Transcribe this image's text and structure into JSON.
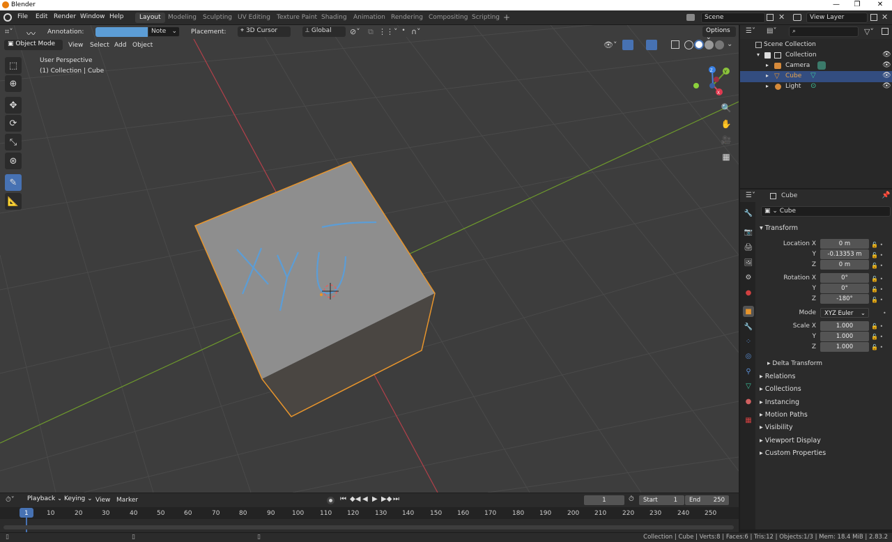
{
  "titlebar": {
    "title": "Blender",
    "min": "—",
    "max": "❐",
    "close": "✕"
  },
  "menu": [
    "File",
    "Edit",
    "Render",
    "Window",
    "Help"
  ],
  "workspaces": [
    "Layout",
    "Modeling",
    "Sculpting",
    "UV Editing",
    "Texture Paint",
    "Shading",
    "Animation",
    "Rendering",
    "Compositing",
    "Scripting"
  ],
  "scene": {
    "name": "Scene",
    "view_layer": "View Layer"
  },
  "tool_header": {
    "annotation_label": "Annotation:",
    "annotation_color": "#5c9dd6",
    "note": "Note",
    "placement_label": "Placement:",
    "placement_value": "3D Cursor",
    "orientation": "Global",
    "options": "Options"
  },
  "viewport_header": {
    "mode": "Object Mode",
    "view": "View",
    "select": "Select",
    "add": "Add",
    "object": "Object"
  },
  "viewport": {
    "perspective": "User Perspective",
    "collection": "(1) Collection | Cube",
    "annotation_text": "XYU"
  },
  "gizmo": {
    "x": "X",
    "y": "Y",
    "z": "Z"
  },
  "outliner": {
    "search_placeholder": "",
    "rows": [
      {
        "label": "Scene Collection"
      },
      {
        "label": "Collection"
      },
      {
        "label": "Camera"
      },
      {
        "label": "Cube"
      },
      {
        "label": "Light"
      }
    ]
  },
  "properties": {
    "object_name": "Cube",
    "data_name": "Cube",
    "transform_label": "Transform",
    "location_x_label": "Location X",
    "location_x": "0 m",
    "location_y_label": "Y",
    "location_y": "-0.13353 m",
    "location_z_label": "Z",
    "location_z": "0 m",
    "rotation_x_label": "Rotation X",
    "rotation_x": "0°",
    "rotation_y_label": "Y",
    "rotation_y": "0°",
    "rotation_z_label": "Z",
    "rotation_z": "-180°",
    "mode_label": "Mode",
    "mode": "XYZ Euler",
    "scale_x_label": "Scale X",
    "scale_x": "1.000",
    "scale_y_label": "Y",
    "scale_y": "1.000",
    "scale_z_label": "Z",
    "scale_z": "1.000",
    "delta_transform": "Delta Transform",
    "sections": [
      "Relations",
      "Collections",
      "Instancing",
      "Motion Paths",
      "Visibility",
      "Viewport Display",
      "Custom Properties"
    ]
  },
  "timeline": {
    "playback": "Playback",
    "keying": "Keying",
    "view": "View",
    "marker": "Marker",
    "current_frame": "1",
    "start_label": "Start",
    "start": "1",
    "end_label": "End",
    "end": "250",
    "ruler": [
      "1",
      "10",
      "20",
      "30",
      "40",
      "50",
      "60",
      "70",
      "80",
      "90",
      "100",
      "110",
      "120",
      "130",
      "140",
      "150",
      "160",
      "170",
      "180",
      "190",
      "200",
      "210",
      "220",
      "230",
      "240",
      "250"
    ]
  },
  "statusbar": {
    "text": "Collection | Cube | Verts:8 | Faces:6 | Tris:12 | Objects:1/3 | Mem: 18.4 MiB | 2.83.2"
  }
}
